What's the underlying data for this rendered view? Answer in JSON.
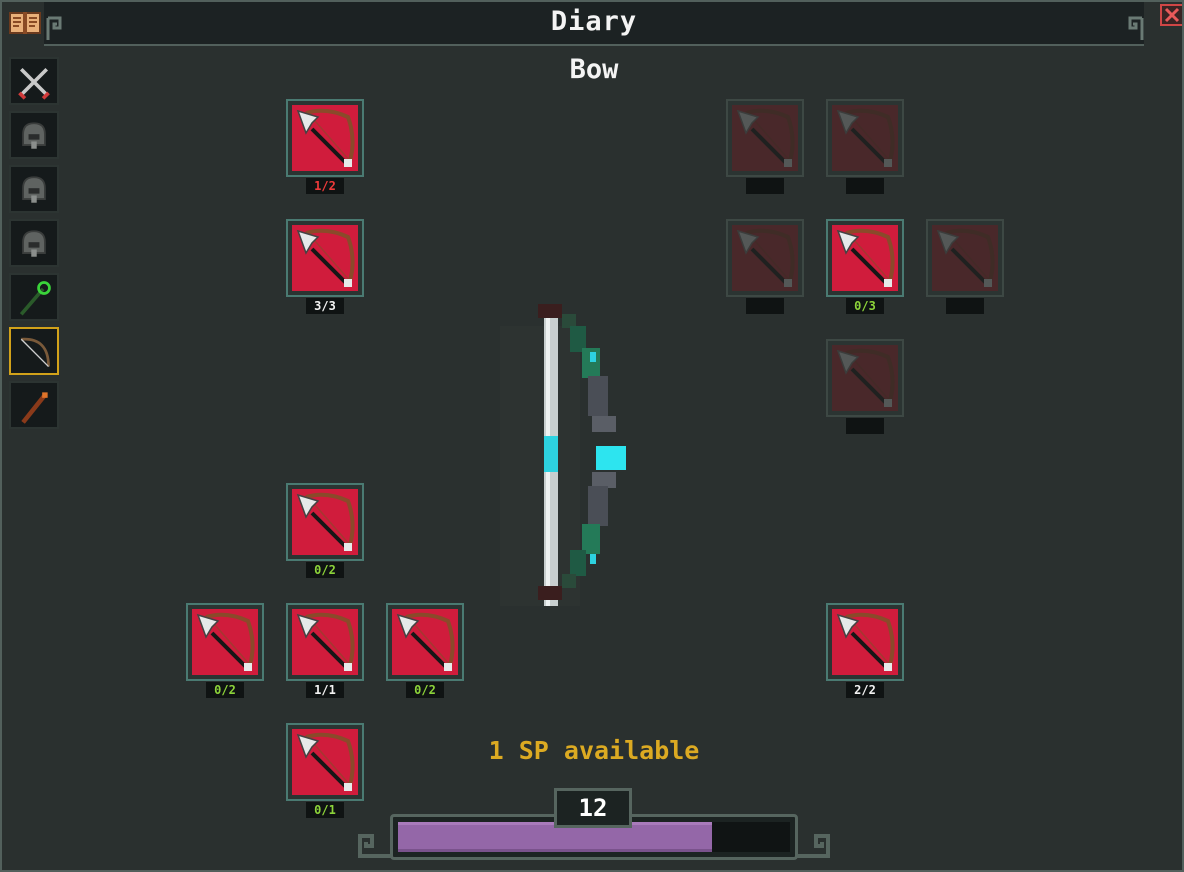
{
  "window": {
    "title": "Diary",
    "close_icon": "close-icon",
    "diary_icon": "book-icon"
  },
  "page": {
    "subtitle": "Bow"
  },
  "tabs": [
    {
      "name": "tab-swords",
      "icon": "crossed-swords-icon",
      "active": false
    },
    {
      "name": "tab-armor-1",
      "icon": "helmet-icon",
      "active": false
    },
    {
      "name": "tab-armor-2",
      "icon": "helmet-icon",
      "active": false
    },
    {
      "name": "tab-armor-3",
      "icon": "helmet-icon",
      "active": false
    },
    {
      "name": "tab-staff",
      "icon": "staff-icon",
      "active": false
    },
    {
      "name": "tab-bow",
      "icon": "bow-icon",
      "active": true
    },
    {
      "name": "tab-wand",
      "icon": "wand-icon",
      "active": false
    }
  ],
  "skills": {
    "left": [
      {
        "level": "1/2",
        "state": "red"
      },
      {
        "level": "3/3",
        "state": "white"
      },
      {
        "level": "0/2",
        "state": "green"
      },
      {
        "level": "0/2",
        "state": "green"
      },
      {
        "level": "1/1",
        "state": "white"
      },
      {
        "level": "0/2",
        "state": "green"
      },
      {
        "level": "0/1",
        "state": "green"
      }
    ],
    "right": [
      {
        "level": "",
        "state": "locked"
      },
      {
        "level": "",
        "state": "locked"
      },
      {
        "level": "",
        "state": "locked"
      },
      {
        "level": "0/3",
        "state": "green"
      },
      {
        "level": "",
        "state": "locked"
      },
      {
        "level": "",
        "state": "locked"
      },
      {
        "level": "2/2",
        "state": "white"
      }
    ]
  },
  "status": {
    "sp_text": "1 SP available",
    "level": "12",
    "xp_progress": 0.8
  },
  "colors": {
    "accent": "#d2a21a",
    "sp_text": "#dcaa22",
    "xp_fill": "#9467a8",
    "node_red": "#d01c3c"
  }
}
